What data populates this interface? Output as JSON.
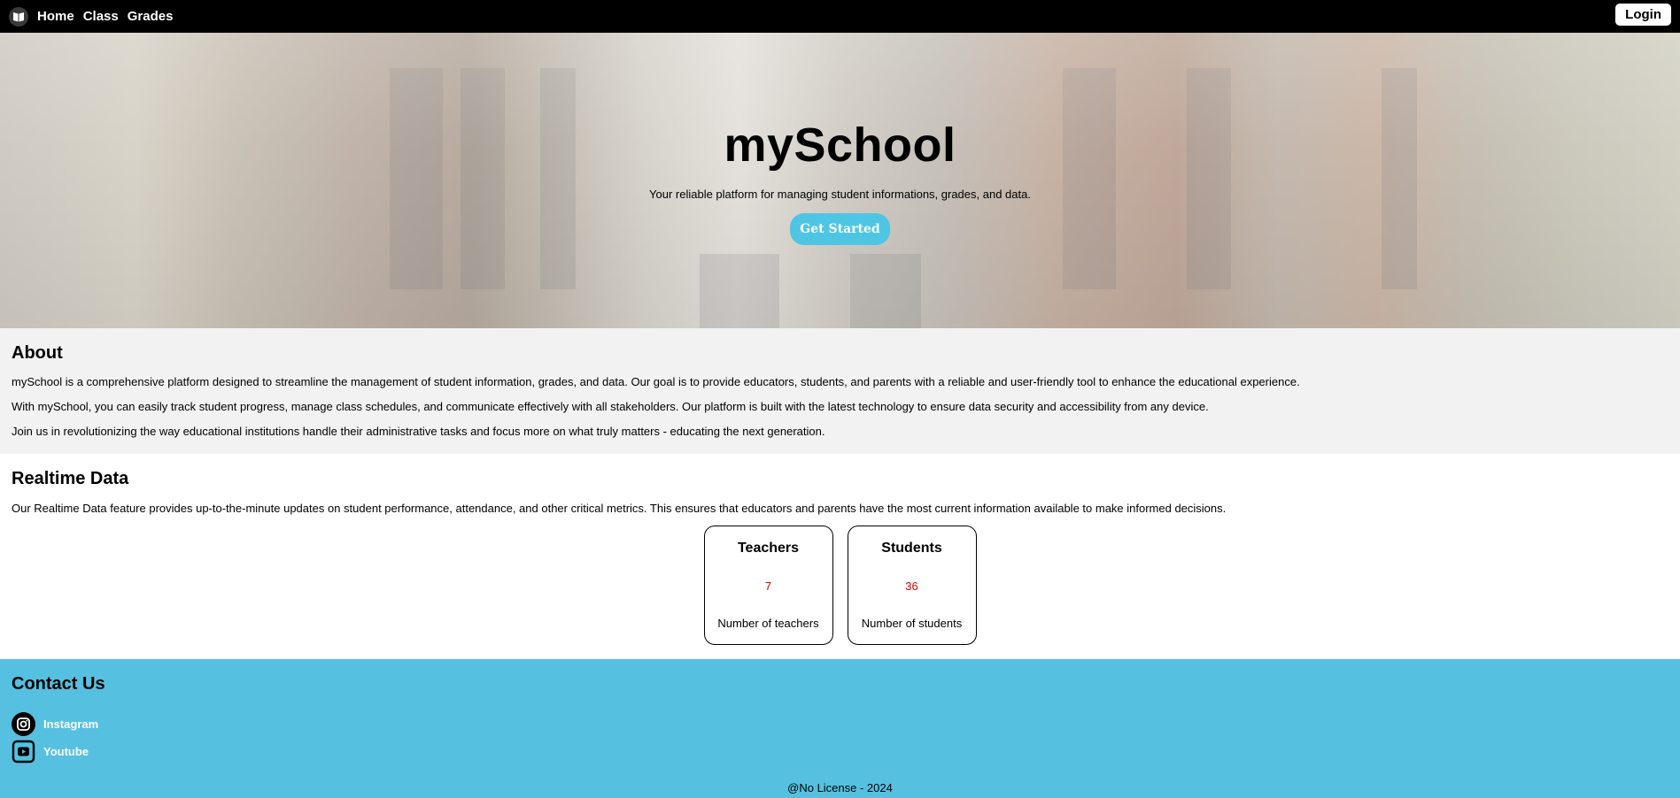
{
  "nav": {
    "logo_icon": "book-icon",
    "links": [
      "Home",
      "Class",
      "Grades"
    ],
    "login_label": "Login"
  },
  "hero": {
    "title": "mySchool",
    "subtitle": "Your reliable platform for managing student informations, grades, and data.",
    "cta_label": "Get Started",
    "cta_color": "#4ec6e3"
  },
  "about": {
    "heading": "About",
    "paragraphs": [
      "mySchool is a comprehensive platform designed to streamline the management of student information, grades, and data. Our goal is to provide educators, students, and parents with a reliable and user-friendly tool to enhance the educational experience.",
      "With mySchool, you can easily track student progress, manage class schedules, and communicate effectively with all stakeholders. Our platform is built with the latest technology to ensure data security and accessibility from any device.",
      "Join us in revolutionizing the way educational institutions handle their administrative tasks and focus more on what truly matters - educating the next generation."
    ]
  },
  "realtime": {
    "heading": "Realtime Data",
    "description": "Our Realtime Data feature provides up-to-the-minute updates on student performance, attendance, and other critical metrics. This ensures that educators and parents have the most current information available to make informed decisions.",
    "cards": [
      {
        "title": "Teachers",
        "value": "7",
        "description": "Number of teachers"
      },
      {
        "title": "Students",
        "value": "36",
        "description": "Number of students"
      }
    ],
    "value_color": "#e00000"
  },
  "contact": {
    "heading": "Contact Us",
    "links": [
      {
        "label": "Instagram",
        "icon": "instagram-icon"
      },
      {
        "label": "Youtube",
        "icon": "youtube-icon"
      }
    ],
    "background_color": "#56c0e0",
    "footer": "@No License - 2024"
  }
}
